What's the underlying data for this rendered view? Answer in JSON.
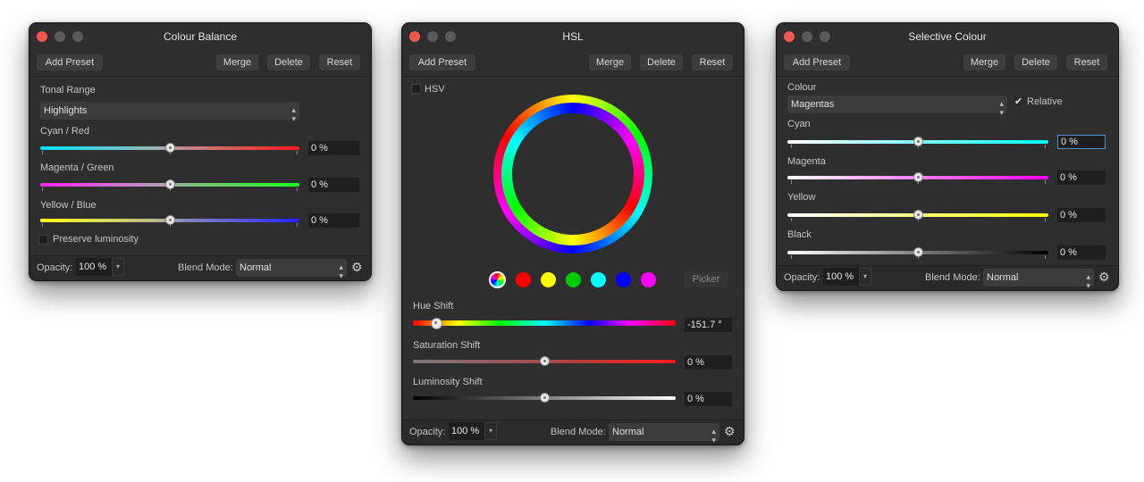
{
  "panels": {
    "colour_balance": {
      "title": "Colour Balance",
      "buttons": {
        "add_preset": "Add Preset",
        "merge": "Merge",
        "delete": "Delete",
        "reset": "Reset"
      },
      "tonal_range_label": "Tonal Range",
      "tonal_range_value": "Highlights",
      "sliders": [
        {
          "label": "Cyan / Red",
          "value": "0 %",
          "level": 0.5
        },
        {
          "label": "Magenta / Green",
          "value": "0 %",
          "level": 0.5
        },
        {
          "label": "Yellow / Blue",
          "value": "0 %",
          "level": 0.5
        }
      ],
      "preserve_luminosity": "Preserve luminosity",
      "opacity_label": "Opacity:",
      "opacity_value": "100 %",
      "blend_label": "Blend Mode:",
      "blend_value": "Normal"
    },
    "hsl": {
      "title": "HSL",
      "buttons": {
        "add_preset": "Add Preset",
        "merge": "Merge",
        "delete": "Delete",
        "reset": "Reset"
      },
      "hsv_label": "HSV",
      "swatches": [
        "#ff0000",
        "#ffff00",
        "#00cc00",
        "#00ffff",
        "#0000ff",
        "#ff00ff"
      ],
      "picker_label": "Picker",
      "sliders": [
        {
          "label": "Hue Shift",
          "value": "-151.7 °",
          "level": 0.09
        },
        {
          "label": "Saturation Shift",
          "value": "0 %",
          "level": 0.5
        },
        {
          "label": "Luminosity Shift",
          "value": "0 %",
          "level": 0.5
        }
      ],
      "opacity_label": "Opacity:",
      "opacity_value": "100 %",
      "blend_label": "Blend Mode:",
      "blend_value": "Normal"
    },
    "selective_colour": {
      "title": "Selective Colour",
      "buttons": {
        "add_preset": "Add Preset",
        "merge": "Merge",
        "delete": "Delete",
        "reset": "Reset"
      },
      "colour_label": "Colour",
      "colour_value": "Magentas",
      "relative_label": "Relative",
      "relative_checked": true,
      "sliders": [
        {
          "label": "Cyan",
          "value": "0 %",
          "level": 0.5
        },
        {
          "label": "Magenta",
          "value": "0 %",
          "level": 0.5
        },
        {
          "label": "Yellow",
          "value": "0 %",
          "level": 0.5
        },
        {
          "label": "Black",
          "value": "0 %",
          "level": 0.5
        }
      ],
      "opacity_label": "Opacity:",
      "opacity_value": "100 %",
      "blend_label": "Blend Mode:",
      "blend_value": "Normal"
    }
  },
  "colors": {
    "panel_bg": "#2e2e2e",
    "close_button": "#f2584f",
    "focus_ring": "#4f8fd6"
  },
  "icons": {
    "gear": "gear-icon",
    "checkmark": "checkmark-icon",
    "updown": "updown-chevron-icon"
  }
}
